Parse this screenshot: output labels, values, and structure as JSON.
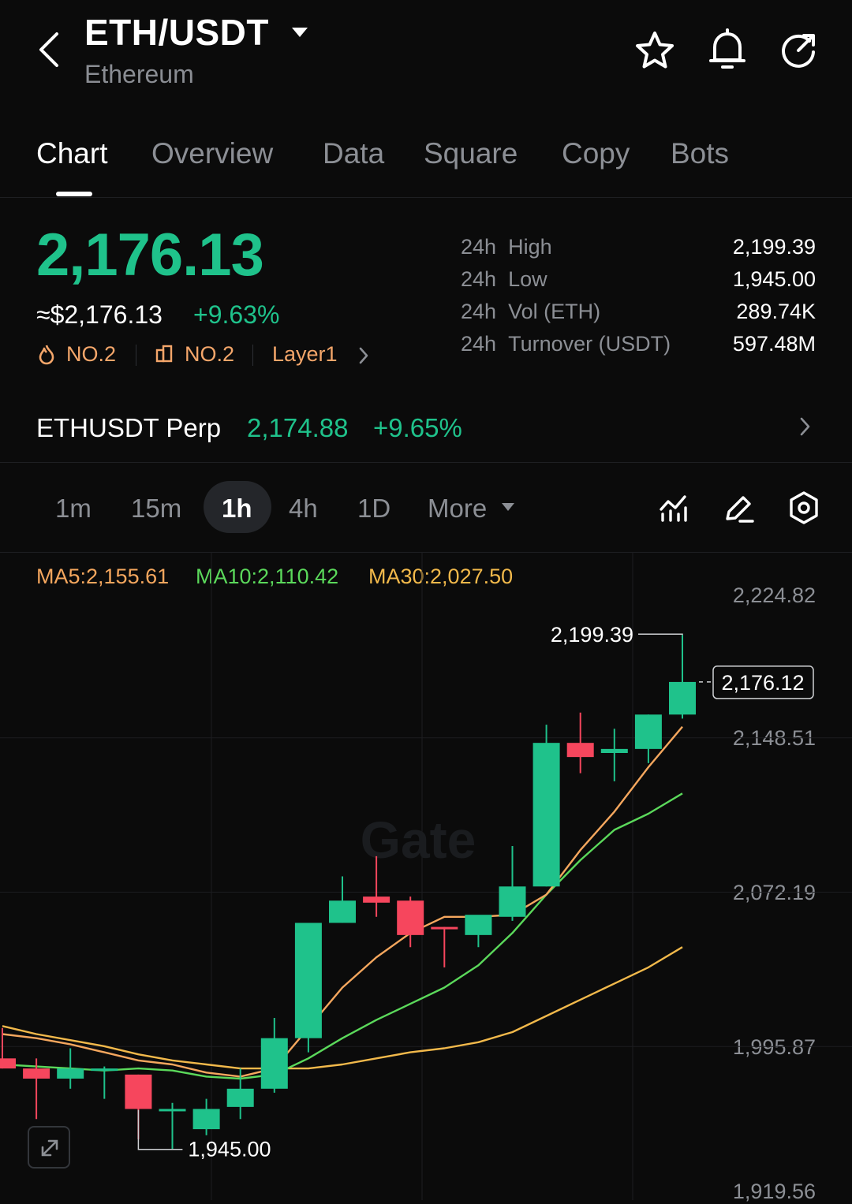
{
  "header": {
    "pair": "ETH/USDT",
    "name": "Ethereum"
  },
  "tabs": [
    "Chart",
    "Overview",
    "Data",
    "Square",
    "Copy",
    "Bots"
  ],
  "ticker": {
    "last_price": "2,176.13",
    "usd_price": "≈$2,176.13",
    "change": "+9.63%",
    "rank_hot": "NO.2",
    "rank_vol": "NO.2",
    "category": "Layer1"
  },
  "stats": [
    {
      "period": "24h",
      "label": "High",
      "value": "2,199.39"
    },
    {
      "period": "24h",
      "label": "Low",
      "value": "1,945.00"
    },
    {
      "period": "24h",
      "label": "Vol (ETH)",
      "value": "289.74K"
    },
    {
      "period": "24h",
      "label": "Turnover (USDT)",
      "value": "597.48M"
    }
  ],
  "perp": {
    "name": "ETHUSDT Perp",
    "price": "2,174.88",
    "change": "+9.65%"
  },
  "intervals": {
    "items": [
      "1m",
      "15m",
      "1h",
      "4h",
      "1D"
    ],
    "selected": "1h",
    "more": "More"
  },
  "ma": {
    "ma5": "MA5:2,155.61",
    "ma10": "MA10:2,110.42",
    "ma30": "MA30:2,027.50"
  },
  "colors": {
    "up": "#1fc28b",
    "down": "#f6465d",
    "ma5": "#f5a75e",
    "ma10": "#5bd95b",
    "ma30": "#f2b94b"
  },
  "watermark": "Gate",
  "chart_data": {
    "type": "candlestick",
    "y_ticks": [
      "2,224.82",
      "2,148.51",
      "2,072.19",
      "1,995.87",
      "1,919.56"
    ],
    "ylim": [
      1919.56,
      2224.82
    ],
    "high_label": "2,199.39",
    "low_label": "1,945.00",
    "current_label": "2,176.12",
    "candles": [
      {
        "o": 1990,
        "h": 2005,
        "l": 1985,
        "c": 1985
      },
      {
        "o": 1985,
        "h": 1990,
        "l": 1960,
        "c": 1980
      },
      {
        "o": 1980,
        "h": 1995,
        "l": 1975,
        "c": 1985
      },
      {
        "o": 1985,
        "h": 1986,
        "l": 1970,
        "c": 1985
      },
      {
        "o": 1982,
        "h": 1982,
        "l": 1950,
        "c": 1965
      },
      {
        "o": 1965,
        "h": 1968,
        "l": 1945,
        "c": 1965
      },
      {
        "o": 1955,
        "h": 1970,
        "l": 1952,
        "c": 1965
      },
      {
        "o": 1966,
        "h": 1985,
        "l": 1960,
        "c": 1975
      },
      {
        "o": 1975,
        "h": 2010,
        "l": 1973,
        "c": 2000
      },
      {
        "o": 2000,
        "h": 2057,
        "l": 1993,
        "c": 2057
      },
      {
        "o": 2057,
        "h": 2080,
        "l": 2057,
        "c": 2068
      },
      {
        "o": 2070,
        "h": 2090,
        "l": 2060,
        "c": 2067
      },
      {
        "o": 2068,
        "h": 2070,
        "l": 2045,
        "c": 2051
      },
      {
        "o": 2055,
        "h": 2055,
        "l": 2035,
        "c": 2054
      },
      {
        "o": 2051,
        "h": 2060,
        "l": 2045,
        "c": 2061
      },
      {
        "o": 2060,
        "h": 2095,
        "l": 2058,
        "c": 2075
      },
      {
        "o": 2075,
        "h": 2155,
        "l": 2075,
        "c": 2146
      },
      {
        "o": 2146,
        "h": 2161,
        "l": 2131,
        "c": 2139
      },
      {
        "o": 2141,
        "h": 2153,
        "l": 2127,
        "c": 2143
      },
      {
        "o": 2143,
        "h": 2160,
        "l": 2136,
        "c": 2160
      },
      {
        "o": 2160,
        "h": 2199.39,
        "l": 2158,
        "c": 2176.12
      }
    ],
    "ma5": [
      2002,
      2000,
      1997,
      1993,
      1989,
      1987,
      1983,
      1981,
      1985,
      2005,
      2025,
      2040,
      2052,
      2060,
      2060,
      2061,
      2071,
      2093,
      2112,
      2134,
      2154
    ],
    "ma10": [
      1987,
      1986,
      1985,
      1984,
      1985,
      1984,
      1981,
      1980,
      1982,
      1990,
      2000,
      2009,
      2017,
      2025,
      2036,
      2052,
      2071,
      2088,
      2103,
      2111,
      2121
    ],
    "ma30": [
      2006,
      2002,
      1999,
      1996,
      1992,
      1989,
      1987,
      1985,
      1985,
      1985,
      1987,
      1990,
      1993,
      1995,
      1998,
      2003,
      2011,
      2019,
      2027,
      2035,
      2045
    ]
  }
}
